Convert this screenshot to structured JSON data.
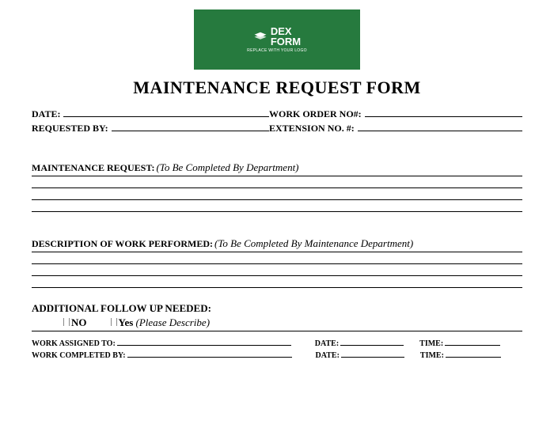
{
  "logo": {
    "line1": "DEX",
    "line2": "FORM",
    "sub": "REPLACE WITH YOUR LOGO"
  },
  "title": "MAINTENANCE REQUEST FORM",
  "fields": {
    "date": "DATE:",
    "workOrder": "WORK ORDER NO#:",
    "requestedBy": "REQUESTED BY:",
    "extension": "EXTENSION NO. #:"
  },
  "sections": {
    "request": {
      "label": "MAINTENANCE REQUEST:",
      "note": "(To Be Completed By Department)"
    },
    "performed": {
      "label": "DESCRIPTION OF WORK PERFORMED:",
      "note": "(To Be Completed By Maintenance Department)"
    },
    "followup": {
      "label": "ADDITIONAL FOLLOW UP NEEDED:"
    }
  },
  "options": {
    "no": "NO",
    "yes": "Yes",
    "describe": "(Please Describe)"
  },
  "bottom": {
    "assigned": "WORK ASSIGNED TO:",
    "completed": "WORK COMPLETED BY:",
    "date": "DATE:",
    "time": "TIME:"
  }
}
